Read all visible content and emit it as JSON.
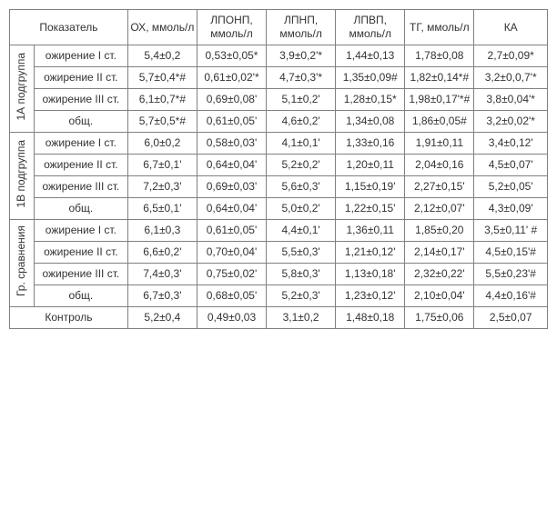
{
  "headers": {
    "indicator": "Показатель",
    "c0": "ОХ, ммоль/л",
    "c1": "ЛПОНП, ммоль/л",
    "c2": "ЛПНП, ммоль/л",
    "c3": "ЛПВП, ммоль/л",
    "c4": "ТГ, ммоль/л",
    "c5": "КА"
  },
  "groups": [
    {
      "name": "1А подгруппа",
      "rows": [
        {
          "label": "ожирение I ст.",
          "v": [
            "5,4±0,2",
            "0,53±0,05*",
            "3,9±0,2'*",
            "1,44±0,13",
            "1,78±0,08",
            "2,7±0,09*"
          ]
        },
        {
          "label": "ожирение II ст.",
          "v": [
            "5,7±0,4*#",
            "0,61±0,02'*",
            "4,7±0,3'*",
            "1,35±0,09#",
            "1,82±0,14*#",
            "3,2±0,0,7'*"
          ]
        },
        {
          "label": "ожирение III ст.",
          "v": [
            "6,1±0,7*#",
            "0,69±0,08'",
            "5,1±0,2'",
            "1,28±0,15*",
            "1,98±0,17'*#",
            "3,8±0,04'*"
          ]
        },
        {
          "label": "общ.",
          "v": [
            "5,7±0,5*#",
            "0,61±0,05'",
            "4,6±0,2'",
            "1,34±0,08",
            "1,86±0,05#",
            "3,2±0,02'*"
          ]
        }
      ]
    },
    {
      "name": "1В подгруппа",
      "rows": [
        {
          "label": "ожирение I ст.",
          "v": [
            "6,0±0,2",
            "0,58±0,03'",
            "4,1±0,1'",
            "1,33±0,16",
            "1,91±0,11",
            "3,4±0,12'"
          ]
        },
        {
          "label": "ожирение II ст.",
          "v": [
            "6,7±0,1'",
            "0,64±0,04'",
            "5,2±0,2'",
            "1,20±0,11",
            "2,04±0,16",
            "4,5±0,07'"
          ]
        },
        {
          "label": "ожирение III ст.",
          "v": [
            "7,2±0,3'",
            "0,69±0,03'",
            "5,6±0,3'",
            "1,15±0,19'",
            "2,27±0,15'",
            "5,2±0,05'"
          ]
        },
        {
          "label": "общ.",
          "v": [
            "6,5±0,1'",
            "0,64±0,04'",
            "5,0±0,2'",
            "1,22±0,15'",
            "2,12±0,07'",
            "4,3±0,09'"
          ]
        }
      ]
    },
    {
      "name": "Гр. сравнения",
      "rows": [
        {
          "label": "ожирение I ст.",
          "v": [
            "6,1±0,3",
            "0,61±0,05'",
            "4,4±0,1'",
            "1,36±0,11",
            "1,85±0,20",
            "3,5±0,11' #"
          ]
        },
        {
          "label": "ожирение II ст.",
          "v": [
            "6,6±0,2'",
            "0,70±0,04'",
            "5,5±0,3'",
            "1,21±0,12'",
            "2,14±0,17'",
            "4,5±0,15'#"
          ]
        },
        {
          "label": "ожирение III ст.",
          "v": [
            "7,4±0,3'",
            "0,75±0,02'",
            "5,8±0,3'",
            "1,13±0,18'",
            "2,32±0,22'",
            "5,5±0,23'#"
          ]
        },
        {
          "label": "общ.",
          "v": [
            "6,7±0,3'",
            "0,68±0,05'",
            "5,2±0,3'",
            "1,23±0,12'",
            "2,10±0,04'",
            "4,4±0,16'#"
          ]
        }
      ]
    }
  ],
  "control": {
    "label": "Контроль",
    "v": [
      "5,2±0,4",
      "0,49±0,03",
      "3,1±0,2",
      "1,48±0,18",
      "1,75±0,06",
      "2,5±0,07"
    ]
  },
  "chart_data": {
    "type": "table",
    "columns": [
      "Показатель (группа)",
      "Показатель (строка)",
      "ОХ, ммоль/л",
      "ЛПОНП, ммоль/л",
      "ЛПНП, ммоль/л",
      "ЛПВП, ммоль/л",
      "ТГ, ммоль/л",
      "КА"
    ],
    "rows": [
      [
        "1А подгруппа",
        "ожирение I ст.",
        "5,4±0,2",
        "0,53±0,05*",
        "3,9±0,2'*",
        "1,44±0,13",
        "1,78±0,08",
        "2,7±0,09*"
      ],
      [
        "1А подгруппа",
        "ожирение II ст.",
        "5,7±0,4*#",
        "0,61±0,02'*",
        "4,7±0,3'*",
        "1,35±0,09#",
        "1,82±0,14*#",
        "3,2±0,0,7'*"
      ],
      [
        "1А подгруппа",
        "ожирение III ст.",
        "6,1±0,7*#",
        "0,69±0,08'",
        "5,1±0,2'",
        "1,28±0,15*",
        "1,98±0,17'*#",
        "3,8±0,04'*"
      ],
      [
        "1А подгруппа",
        "общ.",
        "5,7±0,5*#",
        "0,61±0,05'",
        "4,6±0,2'",
        "1,34±0,08",
        "1,86±0,05#",
        "3,2±0,02'*"
      ],
      [
        "1В подгруппа",
        "ожирение I ст.",
        "6,0±0,2",
        "0,58±0,03'",
        "4,1±0,1'",
        "1,33±0,16",
        "1,91±0,11",
        "3,4±0,12'"
      ],
      [
        "1В подгруппа",
        "ожирение II ст.",
        "6,7±0,1'",
        "0,64±0,04'",
        "5,2±0,2'",
        "1,20±0,11",
        "2,04±0,16",
        "4,5±0,07'"
      ],
      [
        "1В подгруппа",
        "ожирение III ст.",
        "7,2±0,3'",
        "0,69±0,03'",
        "5,6±0,3'",
        "1,15±0,19'",
        "2,27±0,15'",
        "5,2±0,05'"
      ],
      [
        "1В подгруппа",
        "общ.",
        "6,5±0,1'",
        "0,64±0,04'",
        "5,0±0,2'",
        "1,22±0,15'",
        "2,12±0,07'",
        "4,3±0,09'"
      ],
      [
        "Гр. сравнения",
        "ожирение I ст.",
        "6,1±0,3",
        "0,61±0,05'",
        "4,4±0,1'",
        "1,36±0,11",
        "1,85±0,20",
        "3,5±0,11' #"
      ],
      [
        "Гр. сравнения",
        "ожирение II ст.",
        "6,6±0,2'",
        "0,70±0,04'",
        "5,5±0,3'",
        "1,21±0,12'",
        "2,14±0,17'",
        "4,5±0,15'#"
      ],
      [
        "Гр. сравнения",
        "ожирение III ст.",
        "7,4±0,3'",
        "0,75±0,02'",
        "5,8±0,3'",
        "1,13±0,18'",
        "2,32±0,22'",
        "5,5±0,23'#"
      ],
      [
        "Гр. сравнения",
        "общ.",
        "6,7±0,3'",
        "0,68±0,05'",
        "5,2±0,3'",
        "1,23±0,12'",
        "2,10±0,04'",
        "4,4±0,16'#"
      ],
      [
        "Контроль",
        "",
        "5,2±0,4",
        "0,49±0,03",
        "3,1±0,2",
        "1,48±0,18",
        "1,75±0,06",
        "2,5±0,07"
      ]
    ]
  }
}
